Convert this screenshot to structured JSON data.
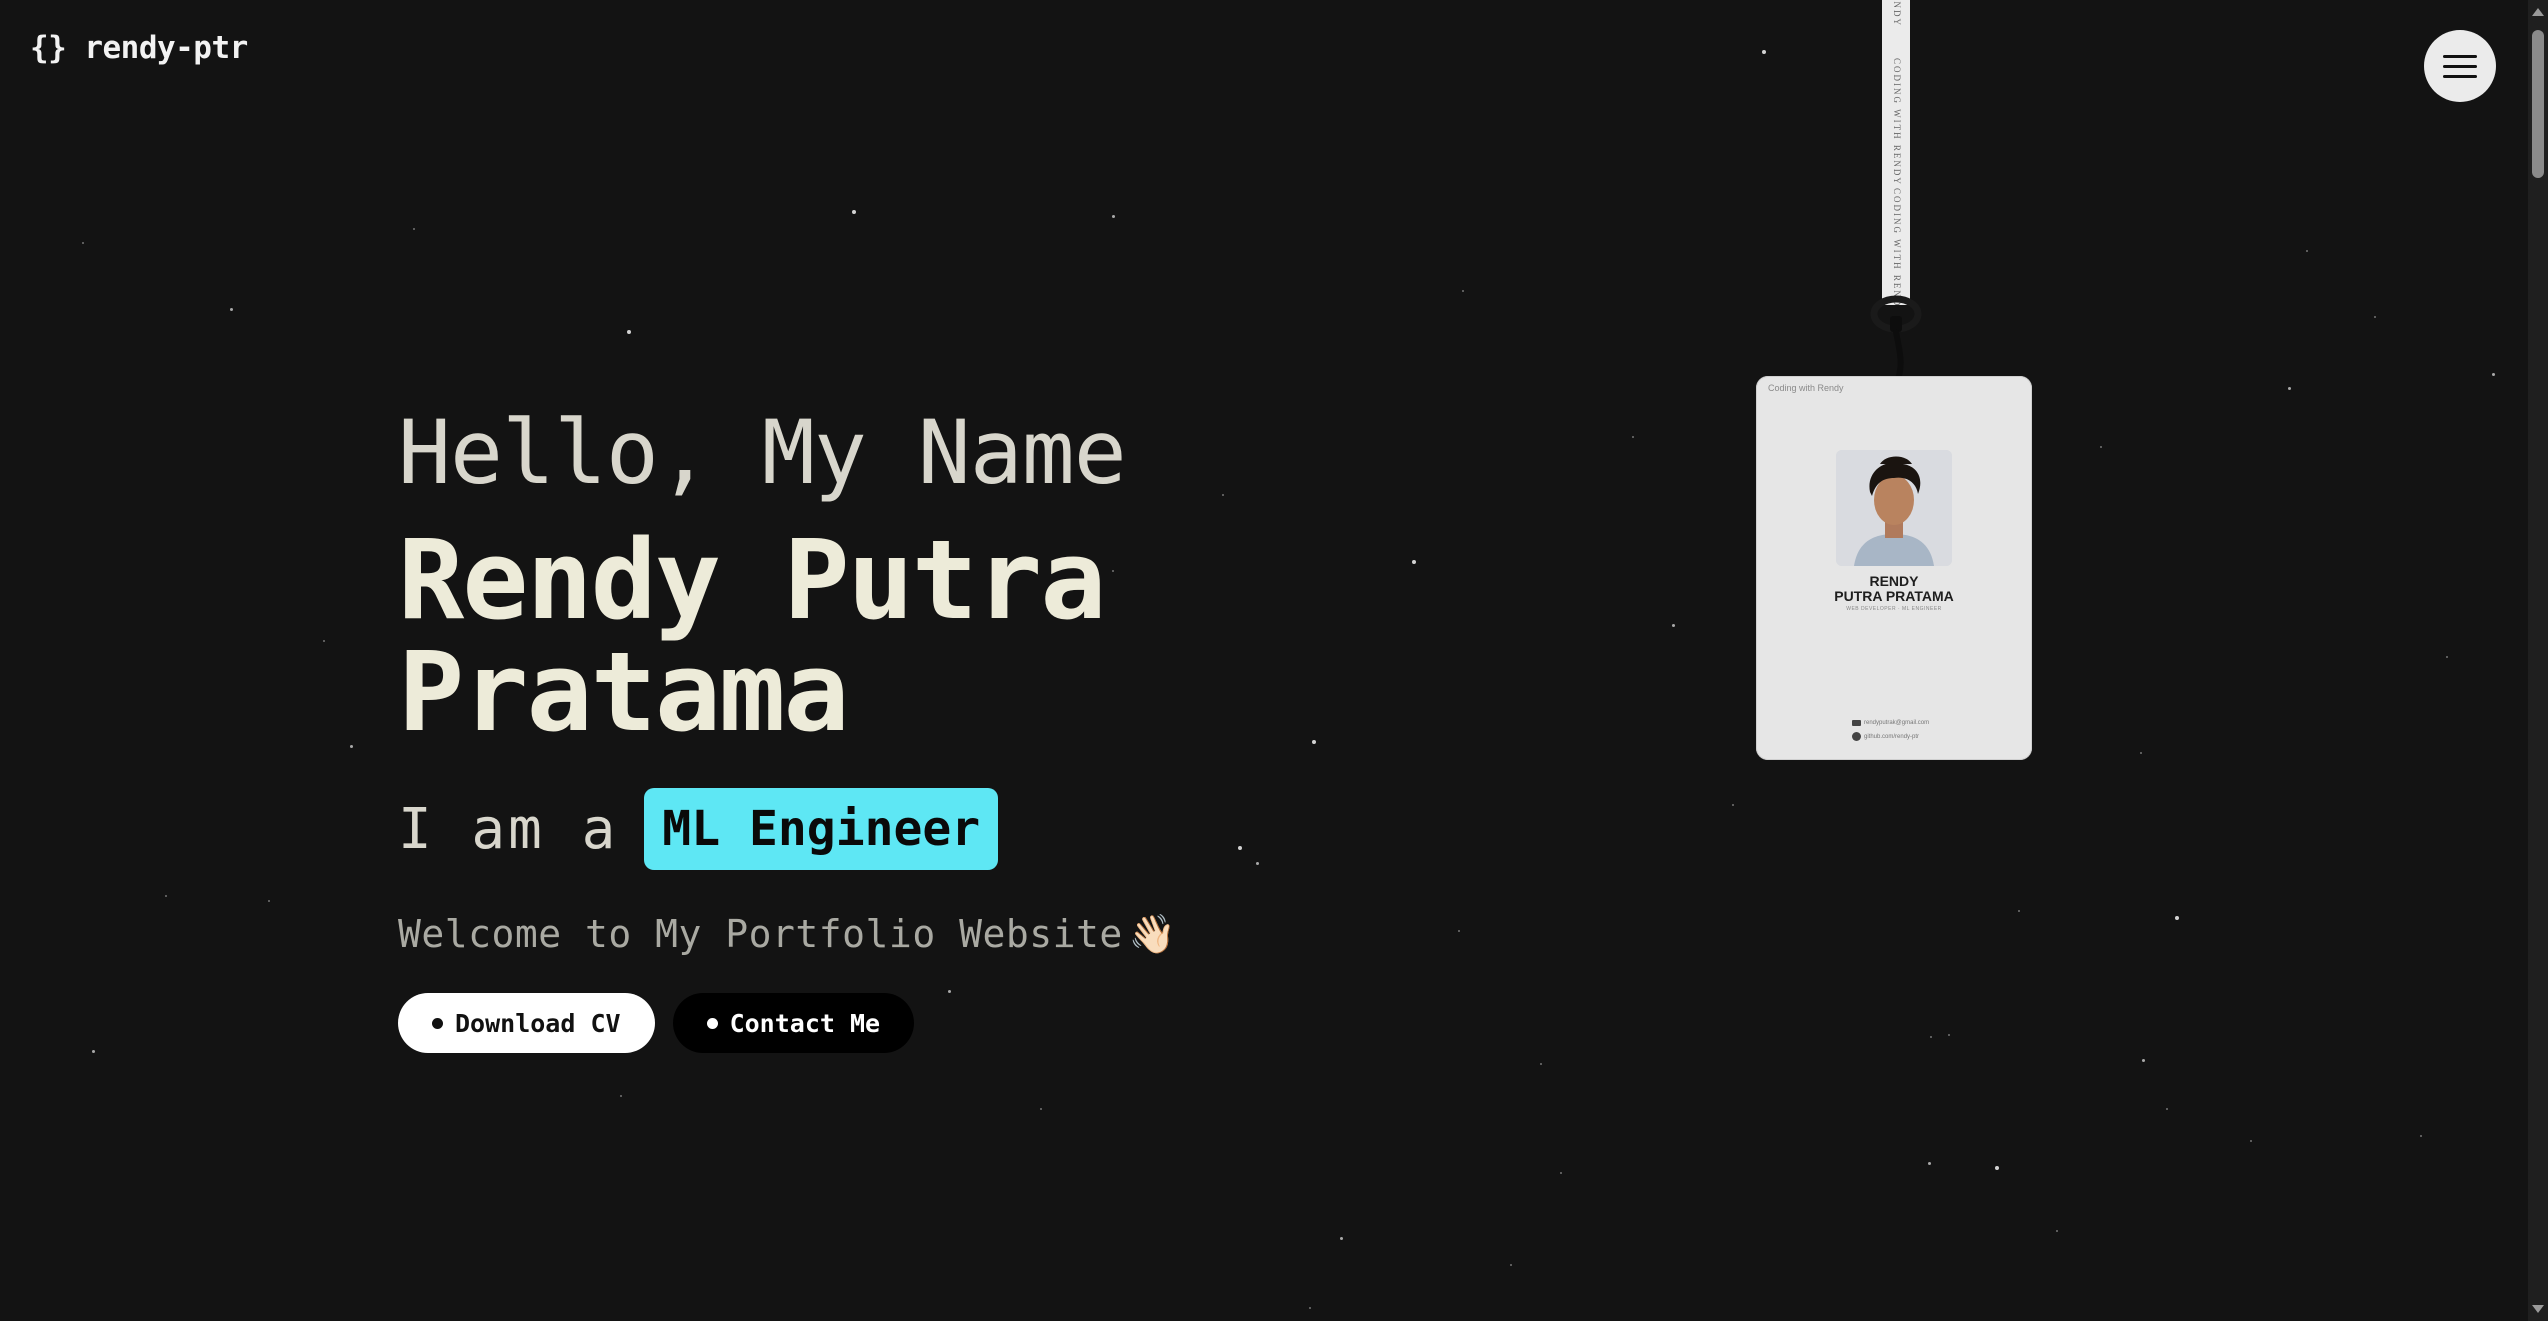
{
  "header": {
    "logo_icon": "{}",
    "logo_text": "rendy-ptr",
    "menu_icon": "hamburger-icon"
  },
  "hero": {
    "greeting": "Hello, My Name",
    "name": "Rendy Putra Pratama",
    "role_prefix": "I am a",
    "role": "ML Engineer",
    "welcome": "Welcome to My Portfolio Website",
    "wave": "👋🏻",
    "download_cv": "Download CV",
    "contact_me": "Contact Me"
  },
  "lanyard": {
    "strap_texts": [
      "ENDY",
      "CODING WITH RENDY",
      "CODING WITH RENDY"
    ]
  },
  "id_card": {
    "brand": "Coding with Rendy",
    "name_line1": "RENDY",
    "name_line2": "PUTRA PRATAMA",
    "subtitle": "WEB DEVELOPER · ML ENGINEER",
    "email": "rendyputrak@gmail.com",
    "github": "github.com/rendy-ptr"
  },
  "colors": {
    "background": "#131313",
    "accent": "#5ee7f4",
    "heading": "#edebd9",
    "muted": "#a9a9a2"
  }
}
